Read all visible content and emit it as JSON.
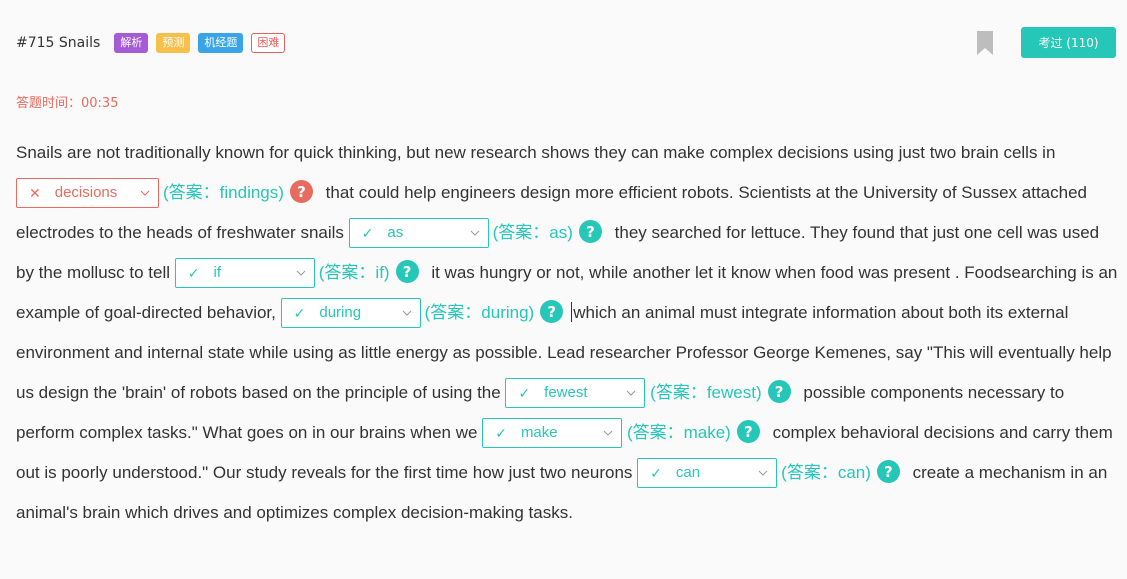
{
  "header": {
    "title": "#715 Snails",
    "tags": [
      "解析",
      "预测",
      "机经题",
      "困难"
    ],
    "passed_label": "考过 (110)"
  },
  "timer": "答题时间：00:35",
  "passage": {
    "t0": "Snails are not traditionally known for quick thinking, but new research shows they can make complex decisions using just two brain cells in",
    "t1": "that could help engineers design more efficient robots. Scientists at the University of Sussex attached electrodes to the heads of freshwater snails",
    "t2": "they searched for lettuce. They found that just one cell was used by the mollusc to tell",
    "t3": "it was hungry or not, while another let it know when food was present . Foodsearching is an example of goal-directed behavior,",
    "t4": "which an animal must integrate information about both its external environment and internal state while using as little energy as possible. Lead researcher Professor George Kemenes, say \"This will eventually help us design the 'brain' of robots based on the principle of using the",
    "t5": "possible components necessary to perform complex tasks.\" What goes on in our brains when we",
    "t6": "complex behavioral decisions and carry them out is poorly understood.\" Our study reveals for the first time how just two neurons",
    "t7": "create a mechanism in an animal's brain which drives and optimizes complex decision-making tasks."
  },
  "blanks": [
    {
      "value": "decisions",
      "answer": "(答案：findings)",
      "status": "wrong"
    },
    {
      "value": "as",
      "answer": "(答案：as)",
      "status": "right"
    },
    {
      "value": "if",
      "answer": "(答案：if)",
      "status": "right"
    },
    {
      "value": "during",
      "answer": "(答案：during)",
      "status": "right"
    },
    {
      "value": "fewest",
      "answer": "(答案：fewest)",
      "status": "right"
    },
    {
      "value": "make",
      "answer": "(答案：make)",
      "status": "right"
    },
    {
      "value": "can",
      "answer": "(答案：can)",
      "status": "right"
    }
  ],
  "icons": {
    "right": "check-icon",
    "wrong": "cross-icon",
    "help": "question-circle-icon",
    "bookmark": "bookmark-icon",
    "dropdown": "chevron-down-icon"
  },
  "colors": {
    "accent": "#26c6b8",
    "error": "#e86b5f"
  }
}
